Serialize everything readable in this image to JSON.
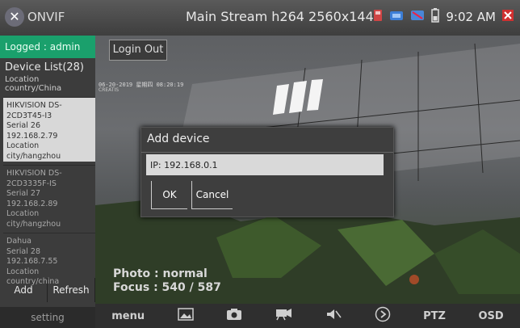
{
  "header": {
    "app_name": "ONVIF",
    "stream_title": "Main Stream h264 2560x1440",
    "time": "9:02 AM"
  },
  "sidebar": {
    "logged": "Logged : admin",
    "device_list_title": "Device List(28)",
    "device_list_subtitle": "Location country/China",
    "devices": [
      {
        "name": "HIKVISION DS-2CD3T45-I3",
        "serial": "Serial 26",
        "ip": "192.168.2.79",
        "location": "Location city/hangzhou"
      },
      {
        "name": "HIKVISION DS-2CD3335F-IS",
        "serial": "Serial 27",
        "ip": "192.168.2.89",
        "location": "Location city/hangzhou"
      },
      {
        "name": "Dahua",
        "serial": "Serial 28",
        "ip": "192.168.7.55",
        "location": "Location country/china"
      }
    ],
    "add_label": "Add",
    "refresh_label": "Refresh",
    "setting_label": "setting"
  },
  "video": {
    "login_out_label": "Login Out",
    "osd_date": "06-20-2019 星期四 08:20:19",
    "osd_name": "CREATIS",
    "photo_mode": "Photo : normal",
    "focus": "Focus : 540 / 587"
  },
  "dialog": {
    "title": "Add device",
    "ip_value": "IP: 192.168.0.1",
    "ok_label": "OK",
    "cancel_label": "Cancel"
  },
  "bottombar": {
    "menu_label": "menu",
    "ptz_label": "PTZ",
    "osd_label": "OSD"
  }
}
